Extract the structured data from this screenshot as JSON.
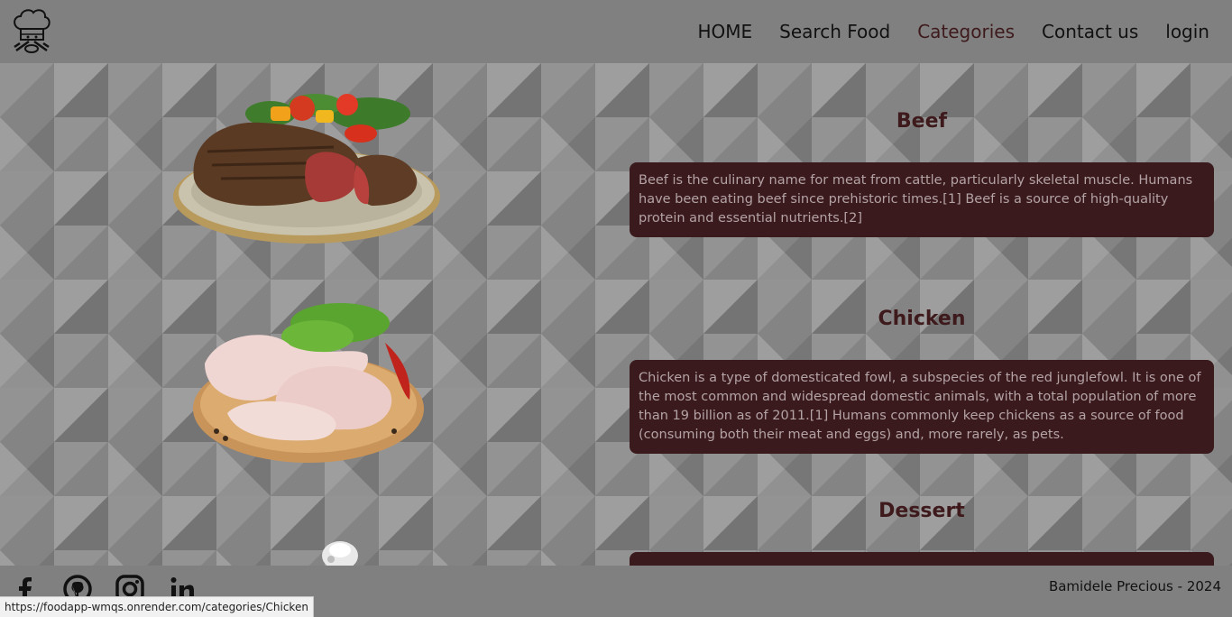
{
  "header": {
    "logo_icon": "chef-hat-icon",
    "nav": [
      {
        "label": "HOME",
        "active": false
      },
      {
        "label": "Search Food",
        "active": false
      },
      {
        "label": "Categories",
        "active": true
      },
      {
        "label": "Contact us",
        "active": false
      },
      {
        "label": "login",
        "active": false
      }
    ]
  },
  "categories": [
    {
      "title": "Beef",
      "description": "Beef is the culinary name for meat from cattle, particularly skeletal muscle. Humans have been eating beef since prehistoric times.[1] Beef is a source of high-quality protein and essential nutrients.[2]",
      "image": "steak-plate-image"
    },
    {
      "title": "Chicken",
      "description": "Chicken is a type of domesticated fowl, a subspecies of the red junglefowl. It is one of the most common and widespread domestic animals, with a total population of more than 19 billion as of 2011.[1] Humans commonly keep chickens as a source of food (consuming both their meat and eggs) and, more rarely, as pets.",
      "image": "raw-chicken-board-image"
    },
    {
      "title": "Dessert",
      "description": "",
      "image": "dessert-image"
    }
  ],
  "footer": {
    "socials": [
      "facebook-icon",
      "github-icon",
      "instagram-icon",
      "linkedin-icon"
    ],
    "credit": "Bamidele Precious - 2024"
  },
  "status_bar_url": "https://foodapp-wmqs.onrender.com/categories/Chicken",
  "colors": {
    "accent": "#3e1a1c",
    "card_bg": "#3b1a1d",
    "card_text": "#b3a3a5",
    "header_bg": "#808080"
  }
}
